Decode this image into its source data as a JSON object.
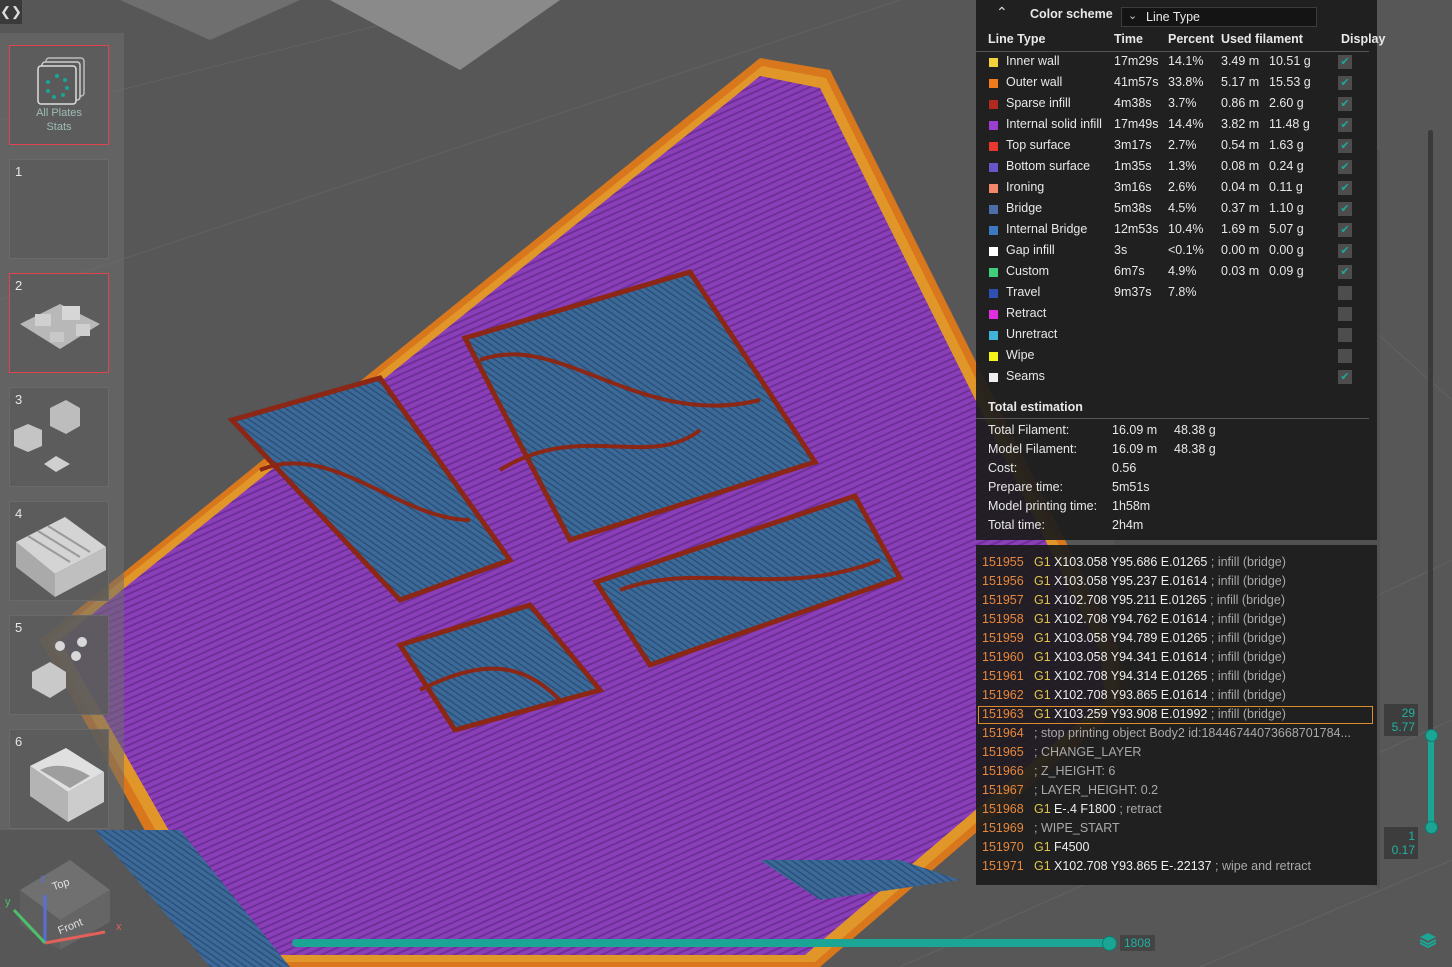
{
  "toolbar": {
    "toggle_icon": "expand-collapse-icon"
  },
  "plates": {
    "all_stats_label_1": "All Plates",
    "all_stats_label_2": "Stats",
    "items": [
      {
        "number": "1",
        "selected": false
      },
      {
        "number": "2",
        "selected": true
      },
      {
        "number": "3",
        "selected": false
      },
      {
        "number": "4",
        "selected": false
      },
      {
        "number": "5",
        "selected": false
      },
      {
        "number": "6",
        "selected": false
      }
    ]
  },
  "legend": {
    "color_scheme_label": "Color scheme",
    "color_scheme_value": "Line Type",
    "columns": [
      "Line Type",
      "Time",
      "Percent",
      "Used filament",
      "Display"
    ],
    "rows": [
      {
        "name": "Inner wall",
        "time": "17m29s",
        "percent": "14.1%",
        "length": "3.49 m",
        "weight": "10.51 g",
        "color": "#f2d13c",
        "display": true
      },
      {
        "name": "Outer wall",
        "time": "41m57s",
        "percent": "33.8%",
        "length": "5.17 m",
        "weight": "15.53 g",
        "color": "#f27c1c",
        "display": true
      },
      {
        "name": "Sparse infill",
        "time": "4m38s",
        "percent": "3.7%",
        "length": "0.86 m",
        "weight": "2.60 g",
        "color": "#b02a1e",
        "display": true
      },
      {
        "name": "Internal solid infill",
        "time": "17m49s",
        "percent": "14.4%",
        "length": "3.82 m",
        "weight": "11.48 g",
        "color": "#9b3fd0",
        "display": true
      },
      {
        "name": "Top surface",
        "time": "3m17s",
        "percent": "2.7%",
        "length": "0.54 m",
        "weight": "1.63 g",
        "color": "#e8382e",
        "display": true
      },
      {
        "name": "Bottom surface",
        "time": "1m35s",
        "percent": "1.3%",
        "length": "0.08 m",
        "weight": "0.24 g",
        "color": "#6a55c8",
        "display": true
      },
      {
        "name": "Ironing",
        "time": "3m16s",
        "percent": "2.6%",
        "length": "0.04 m",
        "weight": "0.11 g",
        "color": "#f2876a",
        "display": true
      },
      {
        "name": "Bridge",
        "time": "5m38s",
        "percent": "4.5%",
        "length": "0.37 m",
        "weight": "1.10 g",
        "color": "#4a6fa8",
        "display": true
      },
      {
        "name": "Internal Bridge",
        "time": "12m53s",
        "percent": "10.4%",
        "length": "1.69 m",
        "weight": "5.07 g",
        "color": "#3c79c0",
        "display": true
      },
      {
        "name": "Gap infill",
        "time": "3s",
        "percent": "<0.1%",
        "length": "0.00 m",
        "weight": "0.00 g",
        "color": "#ffffff",
        "display": true
      },
      {
        "name": "Custom",
        "time": "6m7s",
        "percent": "4.9%",
        "length": "0.03 m",
        "weight": "0.09 g",
        "color": "#3fcf7a",
        "display": true
      },
      {
        "name": "Travel",
        "time": "9m37s",
        "percent": "7.8%",
        "length": "",
        "weight": "",
        "color": "#2e4fb3",
        "display": false
      },
      {
        "name": "Retract",
        "time": "",
        "percent": "",
        "length": "",
        "weight": "",
        "color": "#e02ee0",
        "display": false
      },
      {
        "name": "Unretract",
        "time": "",
        "percent": "",
        "length": "",
        "weight": "",
        "color": "#3fb3d9",
        "display": false
      },
      {
        "name": "Wipe",
        "time": "",
        "percent": "",
        "length": "",
        "weight": "",
        "color": "#f5f51c",
        "display": false
      },
      {
        "name": "Seams",
        "time": "",
        "percent": "",
        "length": "",
        "weight": "",
        "color": "#eeeeee",
        "display": true
      }
    ],
    "total_title": "Total estimation",
    "totals": [
      {
        "label": "Total Filament:",
        "v1": "16.09 m",
        "v2": "48.38 g"
      },
      {
        "label": "Model Filament:",
        "v1": "16.09 m",
        "v2": "48.38 g"
      },
      {
        "label": "Cost:",
        "v1": "0.56",
        "v2": ""
      },
      {
        "label": "Prepare time:",
        "v1": "5m51s",
        "v2": ""
      },
      {
        "label": "Model printing time:",
        "v1": "1h58m",
        "v2": ""
      },
      {
        "label": "Total time:",
        "v1": "2h4m",
        "v2": ""
      }
    ]
  },
  "gcode": {
    "lines": [
      {
        "n": "151955",
        "cmd": "G1",
        "params": "X103.058 Y95.686 E.01265",
        "comment": "; infill (bridge)"
      },
      {
        "n": "151956",
        "cmd": "G1",
        "params": "X103.058 Y95.237 E.01614",
        "comment": "; infill (bridge)"
      },
      {
        "n": "151957",
        "cmd": "G1",
        "params": "X102.708 Y95.211 E.01265",
        "comment": "; infill (bridge)"
      },
      {
        "n": "151958",
        "cmd": "G1",
        "params": "X102.708 Y94.762 E.01614",
        "comment": "; infill (bridge)"
      },
      {
        "n": "151959",
        "cmd": "G1",
        "params": "X103.058 Y94.789 E.01265",
        "comment": "; infill (bridge)"
      },
      {
        "n": "151960",
        "cmd": "G1",
        "params": "X103.058 Y94.341 E.01614",
        "comment": "; infill (bridge)"
      },
      {
        "n": "151961",
        "cmd": "G1",
        "params": "X102.708 Y94.314 E.01265",
        "comment": "; infill (bridge)"
      },
      {
        "n": "151962",
        "cmd": "G1",
        "params": "X102.708 Y93.865 E.01614",
        "comment": "; infill (bridge)"
      },
      {
        "n": "151963",
        "cmd": "G1",
        "params": "X103.259 Y93.908 E.01992",
        "comment": "; infill (bridge)",
        "selected": true
      },
      {
        "n": "151964",
        "cmd": "",
        "params": "",
        "comment": "; stop printing object Body2 id:18446744073668701784..."
      },
      {
        "n": "151965",
        "cmd": "",
        "params": "",
        "comment": "; CHANGE_LAYER"
      },
      {
        "n": "151966",
        "cmd": "",
        "params": "",
        "comment": "; Z_HEIGHT: 6"
      },
      {
        "n": "151967",
        "cmd": "",
        "params": "",
        "comment": "; LAYER_HEIGHT: 0.2"
      },
      {
        "n": "151968",
        "cmd": "G1",
        "params": "E-.4 F1800",
        "comment": "; retract"
      },
      {
        "n": "151969",
        "cmd": "",
        "params": "",
        "comment": "; WIPE_START"
      },
      {
        "n": "151970",
        "cmd": "G1",
        "params": "F4500",
        "comment": ""
      },
      {
        "n": "151971",
        "cmd": "G1",
        "params": "X102.708 Y93.865 E-.22137",
        "comment": "; wipe and retract"
      }
    ]
  },
  "layer_slider": {
    "top_layer": "29",
    "top_height": "5.77",
    "bottom_layer": "1",
    "bottom_height": "0.17"
  },
  "move_slider": {
    "value": "1808",
    "position_fraction": 1.0
  },
  "view_cube": {
    "top": "Top",
    "front": "Front",
    "x": "x",
    "y": "y",
    "z": "z"
  }
}
